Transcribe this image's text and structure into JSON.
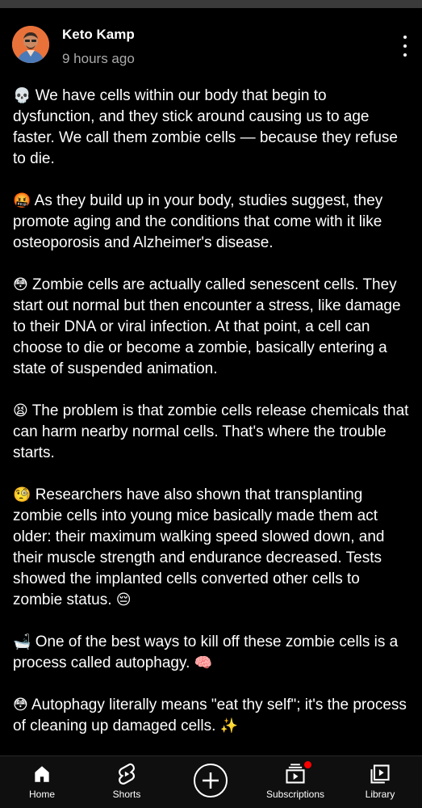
{
  "post": {
    "channel_name": "Keto Kamp",
    "timestamp": "9 hours ago",
    "paragraphs": [
      {
        "emoji": "💀",
        "text": "We have cells within our body that begin to dysfunction, and they stick around causing us to age faster. We call them zombie cells — because they refuse to die."
      },
      {
        "emoji": "🤬",
        "text": "As they build up in your body, studies suggest, they promote aging and the conditions that come with it like osteoporosis and Alzheimer's disease."
      },
      {
        "emoji": "😳",
        "text": "Zombie cells are actually called senescent cells. They start out normal but then encounter a stress, like damage to their DNA or viral infection. At that point, a cell can choose to die or become a zombie, basically entering a state of suspended animation."
      },
      {
        "emoji": "😫",
        "text": "The problem is that zombie cells release chemicals that can harm nearby normal cells. That's where the trouble starts."
      },
      {
        "emoji": "🧐",
        "text": "Researchers have also shown that transplanting zombie cells into young mice basically made them act older: their maximum walking speed slowed down, and their muscle strength and endurance decreased. Tests showed the implanted cells converted other cells to zombie status.",
        "tail_emoji": "😔"
      },
      {
        "emoji": "🛁",
        "text": "One of the best ways to kill off these zombie cells is a process called autophagy.",
        "tail_emoji": "🧠"
      },
      {
        "emoji": "😳",
        "text": "Autophagy literally means \"eat thy self\"; it's the process of cleaning up damaged cells.",
        "tail_emoji": "✨"
      }
    ]
  },
  "nav": {
    "home": "Home",
    "shorts": "Shorts",
    "create": "",
    "subscriptions": "Subscriptions",
    "library": "Library"
  },
  "colors": {
    "background": "#000000",
    "secondary_text": "#aaaaaa",
    "notification_dot": "#ff0000",
    "avatar_bg": "#e9723a"
  },
  "icons": [
    "more-vert-icon",
    "home-icon",
    "shorts-icon",
    "create-icon",
    "subscriptions-icon",
    "library-icon"
  ]
}
